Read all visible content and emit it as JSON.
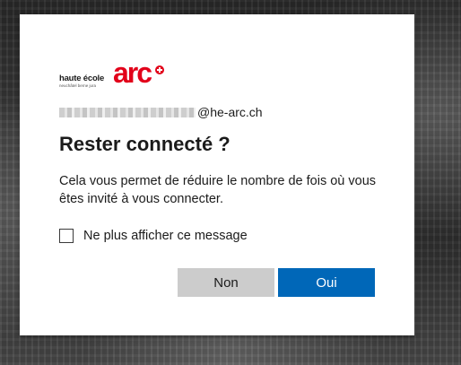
{
  "logo": {
    "line1": "haute école",
    "line2": "neuchâtel berne jura",
    "word": "arc"
  },
  "account": {
    "email_suffix": "@he-arc.ch"
  },
  "dialog": {
    "title": "Rester connecté ?",
    "description": "Cela vous permet de réduire le nombre de fois où vous êtes invité à vous connecter.",
    "checkbox_label": "Ne plus afficher ce message",
    "checkbox_checked": false
  },
  "buttons": {
    "no_label": "Non",
    "yes_label": "Oui"
  },
  "colors": {
    "brand_red": "#e2001a",
    "primary_blue": "#0067b8",
    "secondary_gray": "#cccccc"
  }
}
